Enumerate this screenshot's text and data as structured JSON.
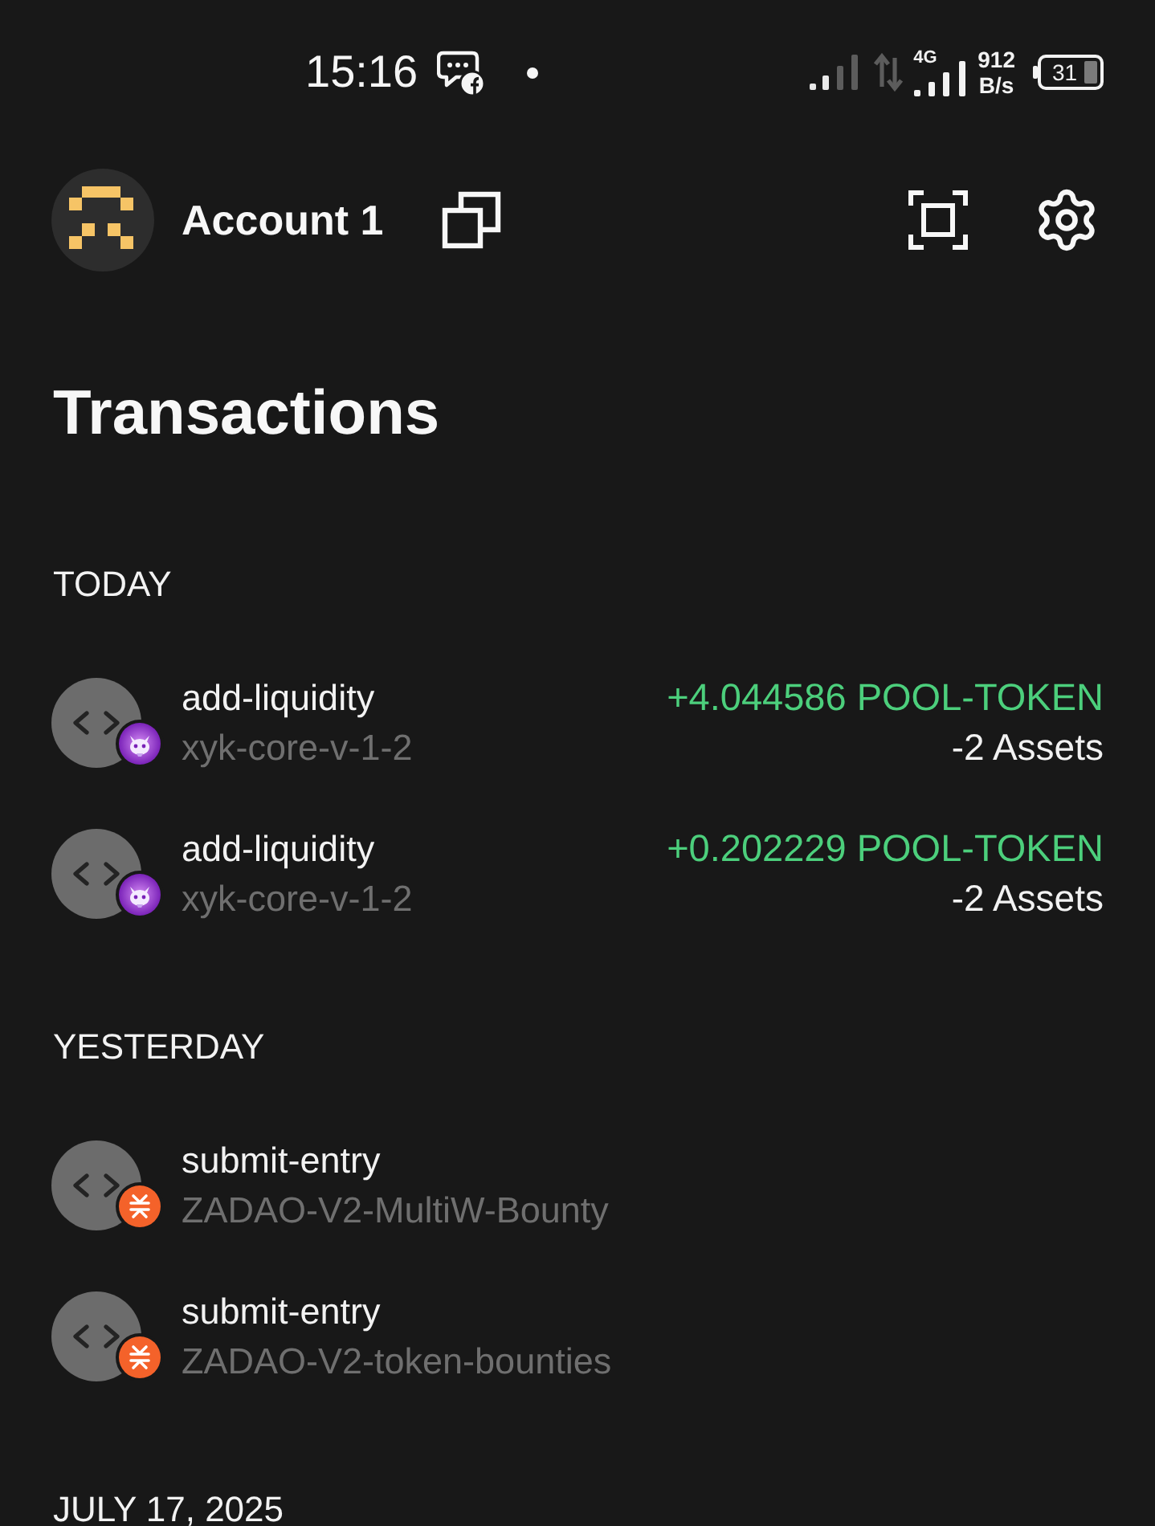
{
  "status_bar": {
    "time": "15:16",
    "network_type": "4G",
    "speed": "912",
    "speed_unit": "B/s",
    "battery": "31"
  },
  "header": {
    "account_name": "Account 1"
  },
  "title": "Transactions",
  "sections": [
    {
      "label": "TODAY",
      "transactions": [
        {
          "function": "add-liquidity",
          "contract": "xyk-core-v-1-2",
          "badge": {
            "kind": "cat"
          },
          "amount": "+4.044586 POOL-TOKEN",
          "assets": "-2 Assets"
        },
        {
          "function": "add-liquidity",
          "contract": "xyk-core-v-1-2",
          "badge": {
            "kind": "cat"
          },
          "amount": "+0.202229 POOL-TOKEN",
          "assets": "-2 Assets"
        }
      ]
    },
    {
      "label": "YESTERDAY",
      "transactions": [
        {
          "function": "submit-entry",
          "contract": "ZADAO-V2-MultiW-Bounty",
          "badge": {
            "kind": "token"
          }
        },
        {
          "function": "submit-entry",
          "contract": "ZADAO-V2-token-bounties",
          "badge": {
            "kind": "token"
          }
        }
      ]
    },
    {
      "label": "JULY 17, 2025"
    }
  ]
}
